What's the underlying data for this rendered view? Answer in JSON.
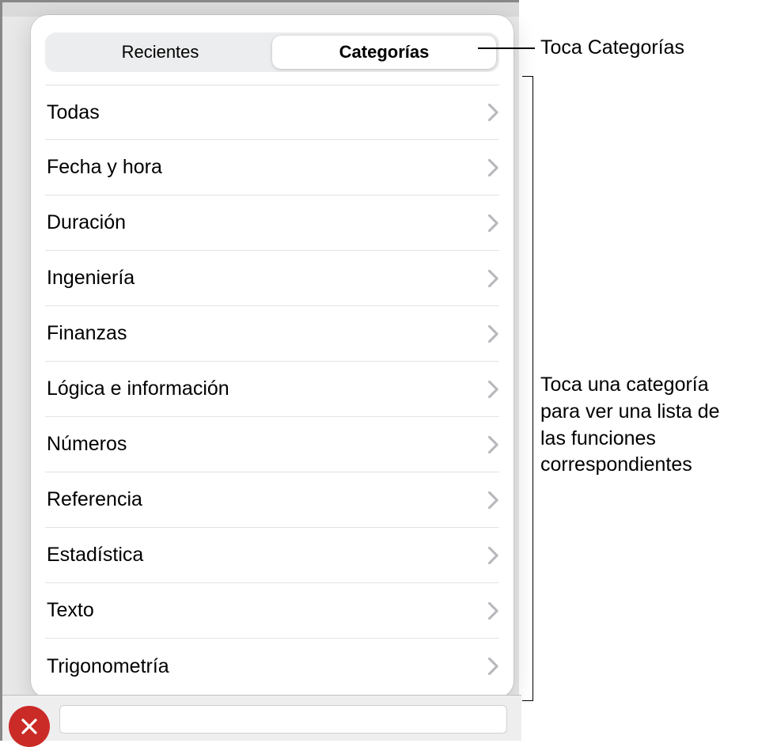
{
  "tabs": {
    "recent": "Recientes",
    "categories": "Categorías"
  },
  "categories": [
    "Todas",
    "Fecha y hora",
    "Duración",
    "Ingeniería",
    "Finanzas",
    "Lógica e información",
    "Números",
    "Referencia",
    "Estadística",
    "Texto",
    "Trigonometría"
  ],
  "callouts": {
    "tap_categories": "Toca Categorías",
    "tap_category_detail": "Toca una categoría para ver una lista de las funciones correspondientes"
  }
}
